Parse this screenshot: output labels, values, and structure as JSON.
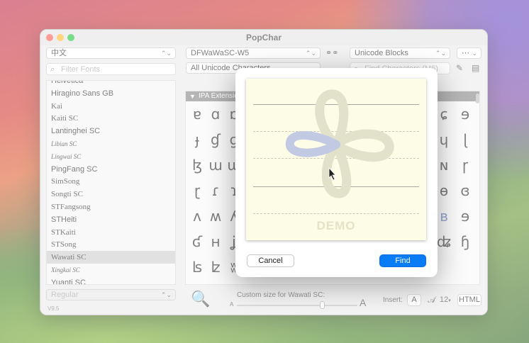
{
  "window": {
    "title": "PopChar",
    "language_popup": "中文",
    "font_popup": "DFWaWaSC-W5",
    "blocks_popup": "Unicode Blocks",
    "filter_popup": "All Unicode Characters",
    "filter_fonts_placeholder": "Filter Fonts",
    "find_chars_placeholder": "Find Characters (M6)",
    "version": "V9.5",
    "style_popup": "Regular"
  },
  "font_list": [
    {
      "label": "Helvetica",
      "style": "sans"
    },
    {
      "label": "Hiragino Sans GB",
      "style": "sans"
    },
    {
      "label": "Kai",
      "style": "serif"
    },
    {
      "label": "Kaiti SC",
      "style": "serif"
    },
    {
      "label": "Lantinghei SC",
      "style": "sans"
    },
    {
      "label": "Libian SC",
      "style": "ital"
    },
    {
      "label": "Lingwai SC",
      "style": "ital"
    },
    {
      "label": "PingFang SC",
      "style": "sans"
    },
    {
      "label": "SimSong",
      "style": "serif"
    },
    {
      "label": "Songti SC",
      "style": "serif"
    },
    {
      "label": "STFangsong",
      "style": "serif"
    },
    {
      "label": "STHeiti",
      "style": "sans"
    },
    {
      "label": "STKaiti",
      "style": "serif"
    },
    {
      "label": "STSong",
      "style": "serif"
    },
    {
      "label": "Wawati SC",
      "style": "serif",
      "selected": true
    },
    {
      "label": "Xingkai SC",
      "style": "ital"
    },
    {
      "label": "Yuanti SC",
      "style": "sans"
    }
  ],
  "grid": {
    "block_header": "IPA Extensions",
    "rows": [
      [
        "ɐ",
        "ɑ",
        "ɒ"
      ],
      [
        "ɟ",
        "ɠ",
        "ɡ"
      ],
      [
        "ɮ",
        "ɯ",
        "ɰ"
      ],
      [
        "ɽ",
        "ɾ",
        "ɿ"
      ],
      [
        "ʌ",
        "ʍ",
        "ʎ"
      ],
      [
        "ʛ",
        "ʜ",
        "ʝ"
      ],
      [
        "ʪ",
        "ʫ",
        "ʬ"
      ]
    ],
    "right_glyphs": [
      [
        "ɕ",
        "ɘ"
      ],
      [
        "ɥ",
        "ɭ"
      ],
      [
        "ɴ",
        "ɼ"
      ],
      [
        "ɵ",
        "ɞ"
      ],
      [
        "ʙ",
        "ɘ"
      ],
      [
        "ʥ",
        "ɧ"
      ]
    ]
  },
  "bottom": {
    "size_label": "Custom size for Wawati SC:",
    "small_a": "A",
    "large_a": "A",
    "insert_label": "Insert:",
    "insert_a": "A",
    "insert_script_a": "𝒜",
    "size_value": "12",
    "html_button": "HTML"
  },
  "dialog": {
    "demo_label": "DEMO",
    "cancel_label": "Cancel",
    "find_label": "Find"
  }
}
